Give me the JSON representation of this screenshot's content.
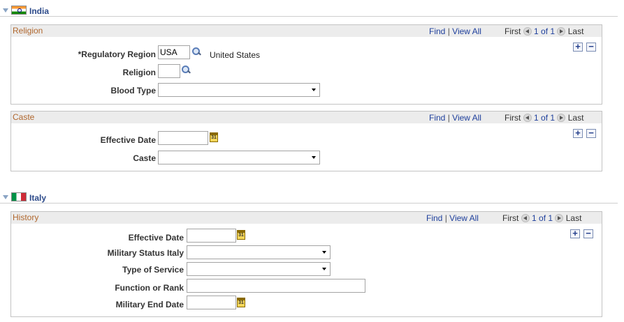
{
  "countries": [
    {
      "name": "India",
      "sections": {
        "religion": {
          "title": "Religion",
          "nav": {
            "find": "Find",
            "sep": "|",
            "view_all": "View All",
            "first": "First",
            "counter": "1 of 1",
            "last": "Last"
          },
          "fields": {
            "regulatory_region_label": "*Regulatory Region",
            "regulatory_region_value": "USA",
            "regulatory_region_desc": "United States",
            "religion_label": "Religion",
            "religion_value": "",
            "blood_type_label": "Blood Type",
            "blood_type_value": ""
          }
        },
        "caste": {
          "title": "Caste",
          "nav": {
            "find": "Find",
            "sep": "|",
            "view_all": "View All",
            "first": "First",
            "counter": "1 of 1",
            "last": "Last"
          },
          "fields": {
            "effective_date_label": "Effective Date",
            "effective_date_value": "",
            "caste_label": "Caste",
            "caste_value": ""
          }
        }
      }
    },
    {
      "name": "Italy",
      "sections": {
        "history": {
          "title": "History",
          "nav": {
            "find": "Find",
            "sep": "|",
            "view_all": "View All",
            "first": "First",
            "counter": "1 of 1",
            "last": "Last"
          },
          "fields": {
            "effective_date_label": "Effective Date",
            "effective_date_value": "",
            "military_status_label": "Military Status Italy",
            "military_status_value": "",
            "type_of_service_label": "Type of Service",
            "type_of_service_value": "",
            "function_rank_label": "Function or Rank",
            "function_rank_value": "",
            "military_end_date_label": "Military End Date",
            "military_end_date_value": ""
          }
        }
      }
    }
  ],
  "icons": {
    "add": "+",
    "remove": "−",
    "calendar": "31",
    "lookup": "lookup-icon"
  },
  "colors": {
    "section_title": "#b0672e",
    "link": "#1e3f9c",
    "country_title": "#2c4a8a"
  }
}
